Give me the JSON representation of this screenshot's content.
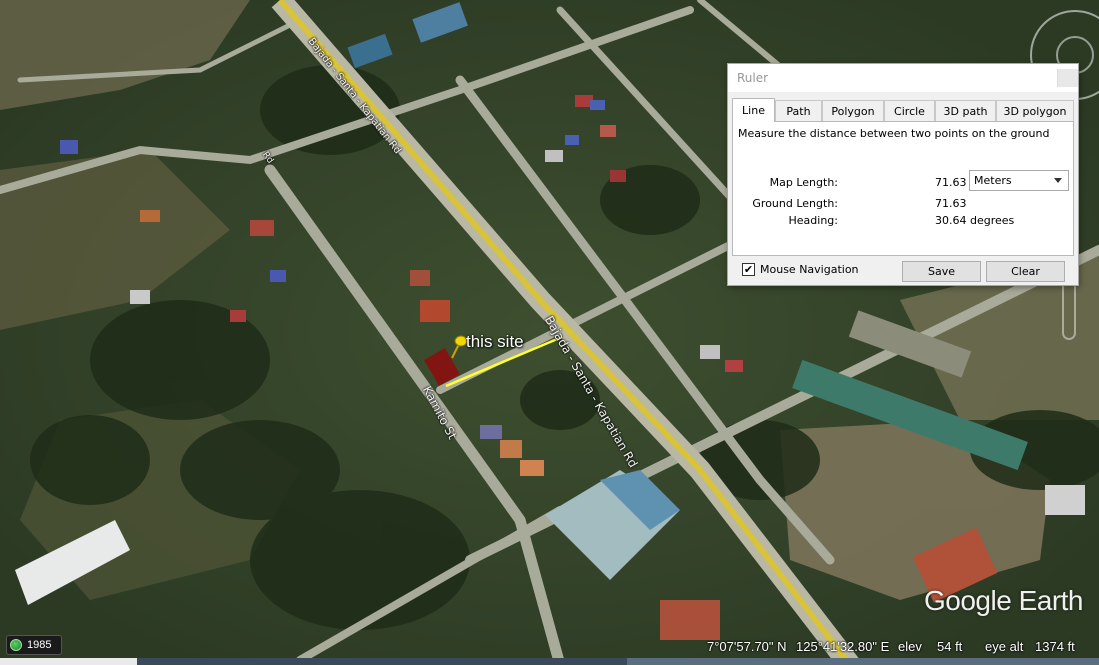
{
  "map": {
    "roads": {
      "main_road": "Bajada - Santa - Kapatian Rd",
      "side_street": "Kamito St",
      "upper_road": "Bajada - Santa - Kapatian Rd",
      "small_road": "Rd"
    },
    "placemark": "this site",
    "watermark": "Google Earth",
    "colors": {
      "measure_line": "#ffff33",
      "pushpin": "#f2d800",
      "lot": "#8b0f0f"
    }
  },
  "status": {
    "year": "1985",
    "latitude": "7°07'57.70\" N",
    "longitude": "125°41'32.80\" E",
    "elev_label": "elev",
    "elev_value": "54 ft",
    "eye_alt_label": "eye alt",
    "eye_alt_value": "1374 ft"
  },
  "ruler": {
    "title": "Ruler",
    "tabs": [
      "Line",
      "Path",
      "Polygon",
      "Circle",
      "3D path",
      "3D polygon"
    ],
    "active_tab": "Line",
    "description": "Measure the distance between two points on the ground",
    "map_length_label": "Map Length:",
    "map_length_value": "71.63",
    "units_selected": "Meters",
    "ground_length_label": "Ground Length:",
    "ground_length_value": "71.63",
    "heading_label": "Heading:",
    "heading_value": "30.64 degrees",
    "mouse_nav_label": "Mouse Navigation",
    "mouse_nav_checked": true,
    "save_label": "Save",
    "clear_label": "Clear"
  }
}
